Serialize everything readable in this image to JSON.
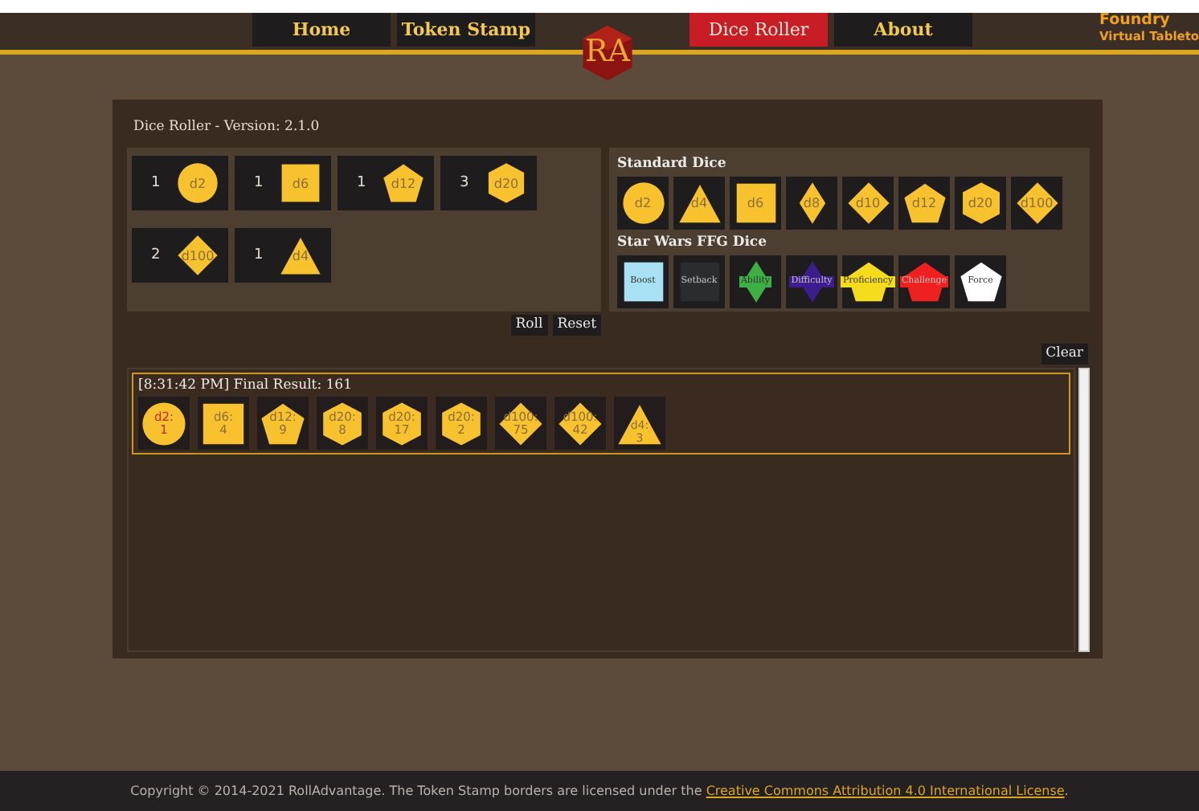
{
  "nav": {
    "items": [
      {
        "label": "Home",
        "selected": false
      },
      {
        "label": "Token Stamp",
        "selected": false
      },
      {
        "label": "Dice Roller",
        "selected": true
      },
      {
        "label": "About",
        "selected": false
      }
    ],
    "logo": "RA",
    "partner_logo": [
      "Foundry",
      "Virtual Tableto"
    ]
  },
  "title": "Dice Roller - Version: 2.1.0",
  "pool": [
    {
      "count": "1",
      "die": "d2",
      "kind": "circle"
    },
    {
      "count": "1",
      "die": "d6",
      "kind": "square"
    },
    {
      "count": "1",
      "die": "d12",
      "kind": "pentagon"
    },
    {
      "count": "3",
      "die": "d20",
      "kind": "hexagon"
    },
    {
      "count": "2",
      "die": "d100",
      "kind": "diamond-wide"
    },
    {
      "count": "1",
      "die": "d4",
      "kind": "triangle"
    }
  ],
  "pool_buttons": [
    "Roll",
    "Reset"
  ],
  "standard_dice": {
    "heading": "Standard Dice",
    "dice": [
      {
        "label": "d2",
        "kind": "circle"
      },
      {
        "label": "d4",
        "kind": "triangle"
      },
      {
        "label": "d6",
        "kind": "square"
      },
      {
        "label": "d8",
        "kind": "diamond"
      },
      {
        "label": "d10",
        "kind": "diamond-wide"
      },
      {
        "label": "d12",
        "kind": "pentagon"
      },
      {
        "label": "d20",
        "kind": "hexagon"
      },
      {
        "label": "d100",
        "kind": "diamond-wide"
      }
    ]
  },
  "star_wars_dice": {
    "heading": "Star Wars FFG Dice",
    "dice": [
      {
        "label": "Boost",
        "kind": "square",
        "color": "#a8e0f4"
      },
      {
        "label": "Setback",
        "kind": "square",
        "color": "#2a2c30"
      },
      {
        "label": "Ability",
        "kind": "diamond",
        "color": "#3cb043"
      },
      {
        "label": "Difficulty",
        "kind": "diamond",
        "color": "#3d1c8c"
      },
      {
        "label": "Proficiency",
        "kind": "pentagon",
        "color": "#f4dc1c"
      },
      {
        "label": "Challenge",
        "kind": "pentagon",
        "color": "#ee2020"
      },
      {
        "label": "Force",
        "kind": "pentagon",
        "color": "#ffffff"
      }
    ]
  },
  "clear_button": "Clear",
  "log": [
    {
      "header": "[8:31:42 PM] Final Result: 161",
      "results": [
        {
          "die": "d2:",
          "value": "1",
          "kind": "circle",
          "lowest": true
        },
        {
          "die": "d6:",
          "value": "4",
          "kind": "square",
          "lowest": false
        },
        {
          "die": "d12:",
          "value": "9",
          "kind": "pentagon",
          "lowest": false
        },
        {
          "die": "d20:",
          "value": "8",
          "kind": "hexagon",
          "lowest": false
        },
        {
          "die": "d20:",
          "value": "17",
          "kind": "hexagon",
          "lowest": false
        },
        {
          "die": "d20:",
          "value": "2",
          "kind": "hexagon",
          "lowest": false
        },
        {
          "die": "d100:",
          "value": "75",
          "kind": "diamond-wide",
          "lowest": false
        },
        {
          "die": "d100:",
          "value": "42",
          "kind": "diamond-wide",
          "lowest": false
        },
        {
          "die": "d4:",
          "value": "3",
          "kind": "triangle",
          "lowest": false
        }
      ]
    }
  ],
  "footer": {
    "text": "Copyright © 2014-2021 RollAdvantage. The Token Stamp borders are licensed under the",
    "link": "Creative Commons Attribution 4.0 International License",
    "after": "."
  }
}
